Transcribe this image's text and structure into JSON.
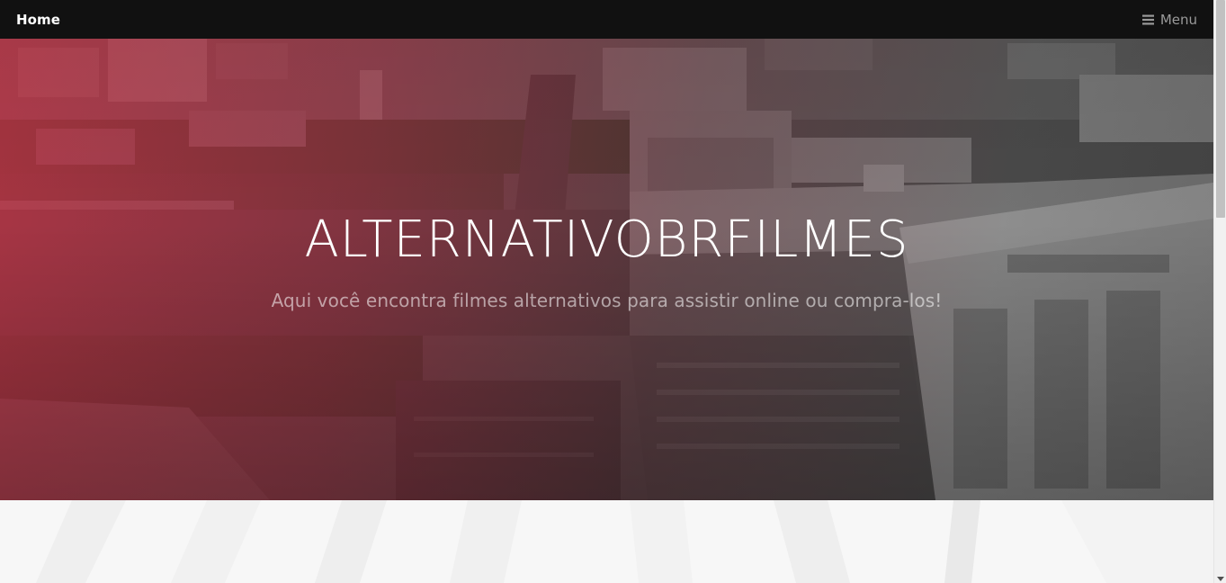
{
  "navbar": {
    "brand": "Home",
    "menu_label": "Menu",
    "menu_icon": "bars-icon",
    "background": "#111111"
  },
  "hero": {
    "title": "ALTERNATIVOBRFILMES",
    "subtitle": "Aqui você encontra filmes alternativos para assistir online ou compra-los!",
    "overlay_color": "#c42e42"
  },
  "scrollbar": {
    "icon_down": "chevron-down-icon"
  }
}
